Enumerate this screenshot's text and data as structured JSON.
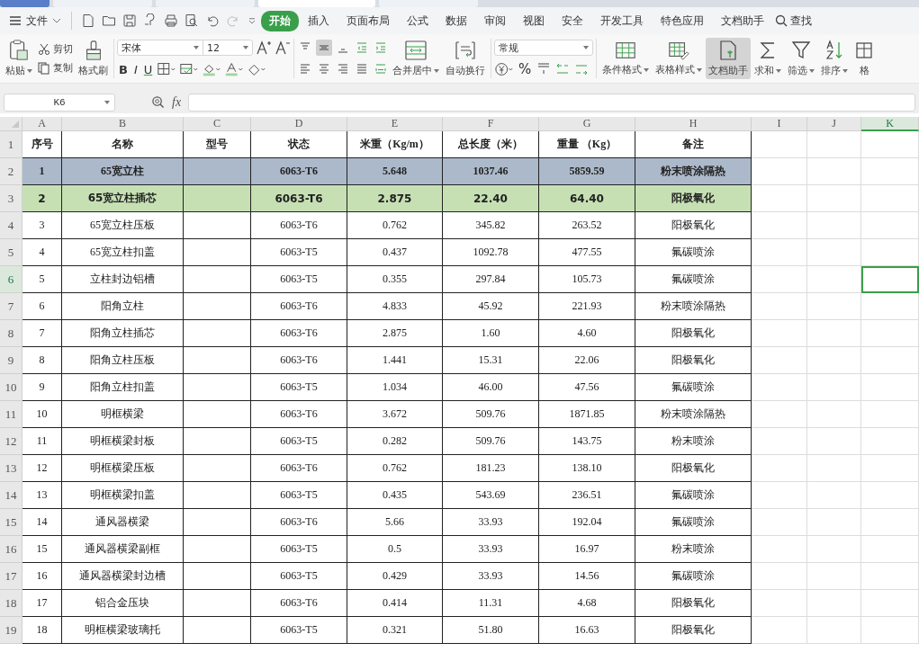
{
  "menu": {
    "file": "文件",
    "search": "查找"
  },
  "ribbon_tabs": [
    {
      "label": "开始",
      "selected": true
    },
    {
      "label": "插入",
      "selected": false
    },
    {
      "label": "页面布局",
      "selected": false
    },
    {
      "label": "公式",
      "selected": false
    },
    {
      "label": "数据",
      "selected": false
    },
    {
      "label": "审阅",
      "selected": false
    },
    {
      "label": "视图",
      "selected": false
    },
    {
      "label": "安全",
      "selected": false
    },
    {
      "label": "开发工具",
      "selected": false
    },
    {
      "label": "特色应用",
      "selected": false
    },
    {
      "label": "文档助手",
      "selected": false
    }
  ],
  "clipboard": {
    "paste": "粘贴",
    "cut": "剪切",
    "copy": "复制",
    "format_painter": "格式刷"
  },
  "font": {
    "name": "宋体",
    "size": "12",
    "styles": [
      "B",
      "I",
      "U"
    ]
  },
  "alignment": {
    "merge": "合并居中",
    "wrap": "自动换行"
  },
  "number": {
    "format": "常规",
    "percent": "%"
  },
  "tools": [
    {
      "kind": "conditional",
      "label": "条件格式",
      "dropdown": true,
      "selected": false
    },
    {
      "kind": "table-style",
      "label": "表格样式",
      "dropdown": true,
      "selected": false
    },
    {
      "kind": "assistant",
      "label": "文档助手",
      "dropdown": false,
      "selected": true
    },
    {
      "kind": "sum",
      "label": "求和",
      "dropdown": true,
      "selected": false
    },
    {
      "kind": "filter",
      "label": "筛选",
      "dropdown": true,
      "selected": false
    },
    {
      "kind": "sort",
      "label": "排序",
      "dropdown": true,
      "selected": false
    },
    {
      "kind": "format",
      "label": "格",
      "dropdown": false,
      "selected": false
    }
  ],
  "formula_bar": {
    "cell": "K6",
    "fx": "fx"
  },
  "columns": [
    {
      "label": "A",
      "selected": false
    },
    {
      "label": "B",
      "selected": false
    },
    {
      "label": "C",
      "selected": false
    },
    {
      "label": "D",
      "selected": false
    },
    {
      "label": "E",
      "selected": false
    },
    {
      "label": "F",
      "selected": false
    },
    {
      "label": "G",
      "selected": false
    },
    {
      "label": "H",
      "selected": false
    },
    {
      "label": "I",
      "selected": false
    },
    {
      "label": "J",
      "selected": false
    },
    {
      "label": "K",
      "selected": true
    }
  ],
  "header_row": {
    "row": "1",
    "selected": false,
    "cells": [
      "序号",
      "名称",
      "型号",
      "状态",
      "米重（Kg/m）",
      "总长度（米）",
      "重量 （Kg）",
      "备注"
    ]
  },
  "rows": [
    {
      "row": "2",
      "kind": "blue",
      "selected": false,
      "no": "1",
      "name": "65宽立柱",
      "state": "6063-T6",
      "unit_weight": "5.648",
      "length": "1037.46",
      "weight": "5859.59",
      "note": "粉末喷涂隔热"
    },
    {
      "row": "3",
      "kind": "green",
      "selected": false,
      "no": "2",
      "name": "65宽立柱插芯",
      "state": "6063-T6",
      "unit_weight": "2.875",
      "length": "22.40",
      "weight": "64.40",
      "note": "阳极氧化"
    },
    {
      "row": "4",
      "kind": "plain",
      "selected": false,
      "no": "3",
      "name": "65宽立柱压板",
      "state": "6063-T6",
      "unit_weight": "0.762",
      "length": "345.82",
      "weight": "263.52",
      "note": "阳极氧化"
    },
    {
      "row": "5",
      "kind": "plain",
      "selected": false,
      "no": "4",
      "name": "65宽立柱扣盖",
      "state": "6063-T5",
      "unit_weight": "0.437",
      "length": "1092.78",
      "weight": "477.55",
      "note": "氟碳喷涂"
    },
    {
      "row": "6",
      "kind": "plain",
      "selected": true,
      "no": "5",
      "name": "立柱封边铝槽",
      "state": "6063-T5",
      "unit_weight": "0.355",
      "length": "297.84",
      "weight": "105.73",
      "note": "氟碳喷涂"
    },
    {
      "row": "7",
      "kind": "plain",
      "selected": false,
      "no": "6",
      "name": "阳角立柱",
      "state": "6063-T6",
      "unit_weight": "4.833",
      "length": "45.92",
      "weight": "221.93",
      "note": "粉末喷涂隔热"
    },
    {
      "row": "8",
      "kind": "plain",
      "selected": false,
      "no": "7",
      "name": "阳角立柱插芯",
      "state": "6063-T6",
      "unit_weight": "2.875",
      "length": "1.60",
      "weight": "4.60",
      "note": "阳极氧化"
    },
    {
      "row": "9",
      "kind": "plain",
      "selected": false,
      "no": "8",
      "name": "阳角立柱压板",
      "state": "6063-T6",
      "unit_weight": "1.441",
      "length": "15.31",
      "weight": "22.06",
      "note": "阳极氧化"
    },
    {
      "row": "10",
      "kind": "plain",
      "selected": false,
      "no": "9",
      "name": "阳角立柱扣盖",
      "state": "6063-T5",
      "unit_weight": "1.034",
      "length": "46.00",
      "weight": "47.56",
      "note": "氟碳喷涂"
    },
    {
      "row": "11",
      "kind": "plain",
      "selected": false,
      "no": "10",
      "name": "明框横梁",
      "state": "6063-T6",
      "unit_weight": "3.672",
      "length": "509.76",
      "weight": "1871.85",
      "note": "粉末喷涂隔热"
    },
    {
      "row": "12",
      "kind": "plain",
      "selected": false,
      "no": "11",
      "name": "明框横梁封板",
      "state": "6063-T5",
      "unit_weight": "0.282",
      "length": "509.76",
      "weight": "143.75",
      "note": "粉末喷涂"
    },
    {
      "row": "13",
      "kind": "plain",
      "selected": false,
      "no": "12",
      "name": "明框横梁压板",
      "state": "6063-T6",
      "unit_weight": "0.762",
      "length": "181.23",
      "weight": "138.10",
      "note": "阳极氧化"
    },
    {
      "row": "14",
      "kind": "plain",
      "selected": false,
      "no": "13",
      "name": "明框横梁扣盖",
      "state": "6063-T5",
      "unit_weight": "0.435",
      "length": "543.69",
      "weight": "236.51",
      "note": "氟碳喷涂"
    },
    {
      "row": "15",
      "kind": "plain",
      "selected": false,
      "no": "14",
      "name": "通风器横梁",
      "state": "6063-T6",
      "unit_weight": "5.66",
      "length": "33.93",
      "weight": "192.04",
      "note": "氟碳喷涂"
    },
    {
      "row": "16",
      "kind": "plain",
      "selected": false,
      "no": "15",
      "name": "通风器横梁副框",
      "state": "6063-T5",
      "unit_weight": "0.5",
      "length": "33.93",
      "weight": "16.97",
      "note": "粉末喷涂"
    },
    {
      "row": "17",
      "kind": "plain",
      "selected": false,
      "no": "16",
      "name": "通风器横梁封边槽",
      "state": "6063-T5",
      "unit_weight": "0.429",
      "length": "33.93",
      "weight": "14.56",
      "note": "氟碳喷涂"
    },
    {
      "row": "18",
      "kind": "plain",
      "selected": false,
      "no": "17",
      "name": "铝合金压块",
      "state": "6063-T6",
      "unit_weight": "0.414",
      "length": "11.31",
      "weight": "4.68",
      "note": "阳极氧化"
    },
    {
      "row": "19",
      "kind": "plain",
      "selected": false,
      "no": "18",
      "name": "明框横梁玻璃托",
      "state": "6063-T5",
      "unit_weight": "0.321",
      "length": "51.80",
      "weight": "16.63",
      "note": "阳极氧化"
    }
  ]
}
